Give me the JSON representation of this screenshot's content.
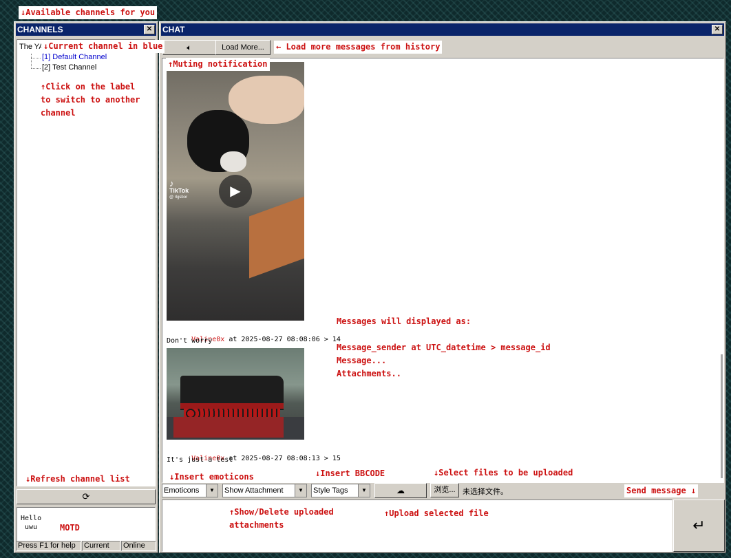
{
  "annotations": {
    "available_channels": "↓Available channels for you",
    "current_channel": "↓Current channel in blue",
    "load_more": "← Load more messages from history",
    "muting": "↑Muting notification",
    "click_label": "↑Click on the label\nto switch to another\nchannel",
    "message_format": "Messages will displayed as:\n\nMessage_sender at UTC_datetime > message_id\nMessage...\nAttachments..",
    "refresh": "↓Refresh channel list",
    "insert_emoticons": "↓Insert emoticons",
    "insert_bbcode": "↓Insert BBCODE",
    "select_files": "↓Select files to be uploaded",
    "send_message": "Send message ↓",
    "show_delete": "↑Show/Delete uploaded\nattachments",
    "upload_file": "↑Upload selected file",
    "motd": "MOTD"
  },
  "channels_window": {
    "title": "CHANNELS",
    "root_label": "The YA",
    "items": [
      {
        "label": "[1] Default Channel",
        "current": true
      },
      {
        "label": "[2] Test Channel",
        "current": false
      }
    ],
    "motd_lines": [
      "Hello",
      " uwu"
    ],
    "status": [
      "Press F1 for help",
      "Current",
      "Online"
    ]
  },
  "chat_window": {
    "title": "CHAT",
    "load_more_label": "Load More...",
    "video_overlay": {
      "brand": "TikTok",
      "handle": "@ rlgsbor"
    },
    "messages": [
      {
        "sender": "Valine0x",
        "meta": " at 2025-08-27 08:08:06 > 14",
        "text": "Don't worry"
      },
      {
        "sender": "Valine0x",
        "meta": " at 2025-08-27 08:08:13 > 15",
        "text": "It's just a test"
      }
    ],
    "toolbar": {
      "emoticons": "Emoticons",
      "attachments": "Show Attachment",
      "style_tags": "Style Tags",
      "browse": "浏览...",
      "no_file": "未选择文件。"
    }
  }
}
